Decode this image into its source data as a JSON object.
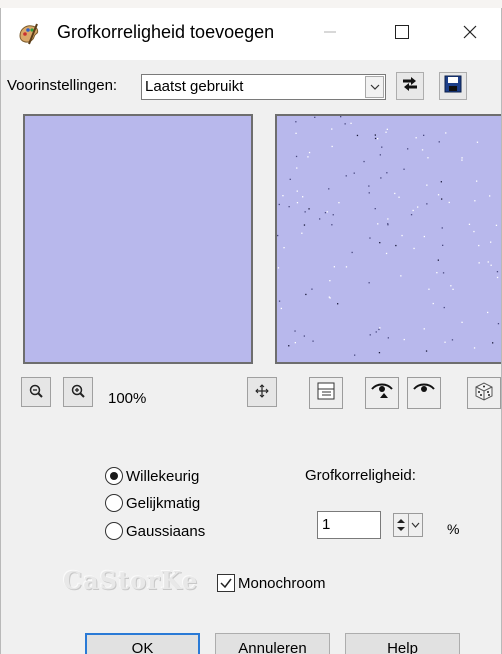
{
  "window": {
    "title": "Grofkorreligheid toevoegen"
  },
  "presets": {
    "label": "Voorinstellingen:",
    "value": "Laatst gebruikt"
  },
  "preview": {
    "zoom": "100%",
    "original_color": "#b8b8ec",
    "result_color": "#b8b8ec"
  },
  "noise_type": {
    "options": [
      "Willekeurig",
      "Gelijkmatig",
      "Gaussiaans"
    ],
    "selected": "Willekeurig"
  },
  "grain": {
    "label": "Grofkorreligheid:",
    "value": "1",
    "unit": "%"
  },
  "monochrome": {
    "label": "Monochroom",
    "checked": true
  },
  "watermark": "CaStorKe",
  "buttons": {
    "ok": "OK",
    "cancel": "Annuleren",
    "help": "Help"
  }
}
